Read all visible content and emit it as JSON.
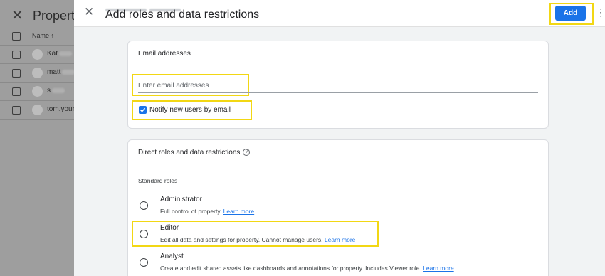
{
  "background": {
    "title": "Property",
    "column_header": "Name",
    "sort_icon": "arrow-up-icon",
    "users": [
      "Kat",
      "matt",
      "s",
      "tom.youn"
    ]
  },
  "panel": {
    "title": "Add roles and data restrictions",
    "add_label": "Add",
    "email_card": {
      "header": "Email addresses",
      "placeholder": "Enter email addresses",
      "notify_label": "Notify new users by email",
      "notify_checked": true
    },
    "roles_card": {
      "header": "Direct roles and data restrictions",
      "subheader": "Standard roles",
      "roles": [
        {
          "name": "Administrator",
          "desc": "Full control of property.",
          "link": "Learn more"
        },
        {
          "name": "Editor",
          "desc": "Edit all data and settings for property. Cannot manage users.",
          "link": "Learn more"
        },
        {
          "name": "Analyst",
          "desc": "Create and edit shared assets like dashboards and annotations for property. Includes Viewer role.",
          "link": "Learn more"
        }
      ]
    }
  },
  "colors": {
    "accent": "#1a73e8",
    "highlight": "#f2d714",
    "overlay": "#9e9e9e"
  }
}
